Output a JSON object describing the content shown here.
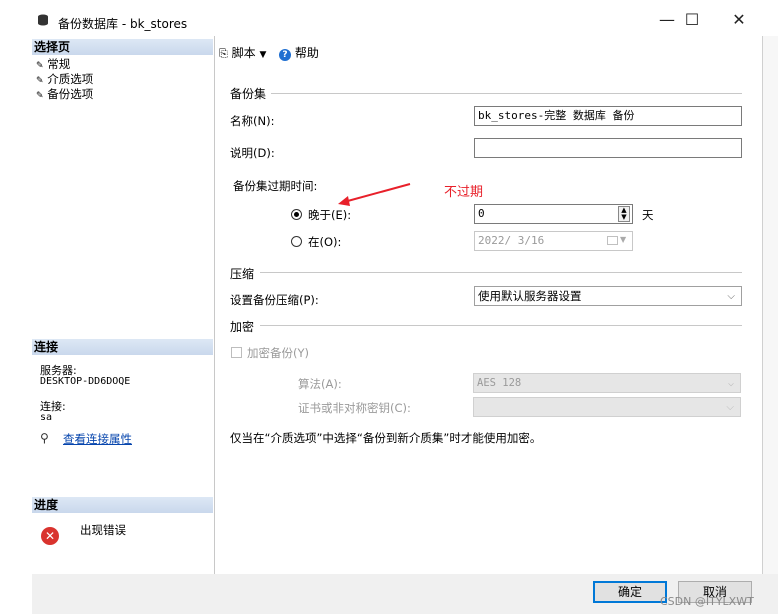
{
  "window": {
    "title": "备份数据库 - bk_stores",
    "minimize": "—",
    "maximize": "☐",
    "close": "✕"
  },
  "left": {
    "select_page_heading": "选择页",
    "pages": [
      "常规",
      "介质选项",
      "备份选项"
    ],
    "connection_heading": "连接",
    "server_label": "服务器:",
    "server_value": "DESKTOP-DD6DOQE",
    "connection_label": "连接:",
    "connection_value": "sa",
    "view_connection_link": "查看连接属性",
    "progress_heading": "进度",
    "progress_status": "出现错误"
  },
  "toolbar": {
    "script_label": "脚本",
    "help_label": "帮助"
  },
  "backup_set": {
    "section_label": "备份集",
    "name_label": "名称(N):",
    "name_value": "bk_stores-完整 数据库 备份",
    "desc_label": "说明(D):",
    "desc_value": "",
    "expire_label": "备份集过期时间:",
    "after_label": "晚于(E):",
    "after_value": "0",
    "days_unit": "天",
    "on_label": "在(O):",
    "on_value": "2022/ 3/16",
    "annotation": "不过期"
  },
  "compression": {
    "section_label": "压缩",
    "setting_label": "设置备份压缩(P):",
    "setting_value": "使用默认服务器设置"
  },
  "encryption": {
    "section_label": "加密",
    "encrypt_label": "加密备份(Y)",
    "algorithm_label": "算法(A):",
    "algorithm_value": "AES 128",
    "cert_label": "证书或非对称密钥(C):",
    "cert_value": "",
    "note": "仅当在“介质选项”中选择“备份到新介质集”时才能使用加密。"
  },
  "footer": {
    "ok_label": "确定",
    "cancel_label": "取消"
  },
  "watermark": "CSDN @ITYLXWT",
  "colors": {
    "accent": "#0078d7",
    "annotation": "#e8202a",
    "error": "#d9332e",
    "heading_bg": "#cfdcef"
  }
}
